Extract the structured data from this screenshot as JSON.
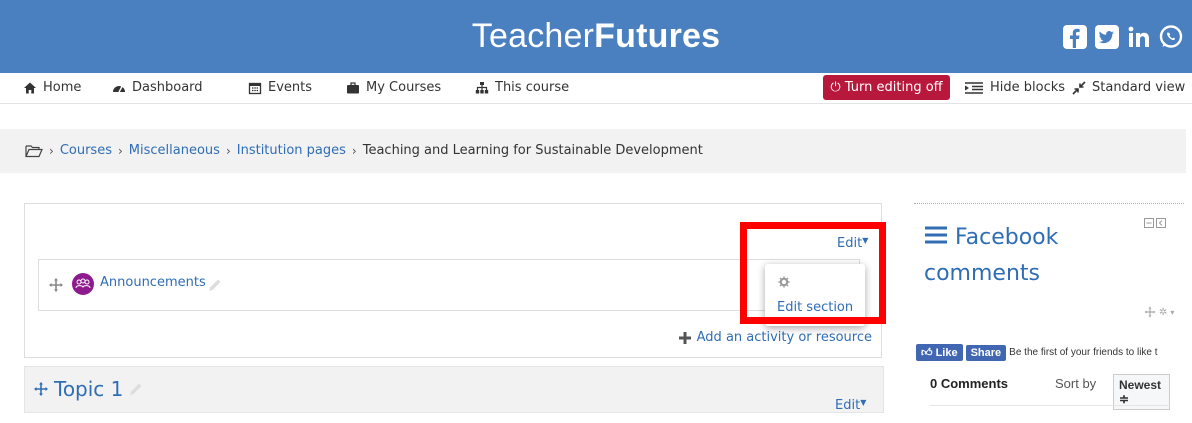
{
  "header": {
    "brand_thin": "Teacher",
    "brand_bold": "Futures",
    "social_icons": [
      "facebook-icon",
      "twitter-icon",
      "linkedin-icon",
      "whatsapp-icon"
    ]
  },
  "nav": {
    "home": "Home",
    "dashboard": "Dashboard",
    "events": "Events",
    "my_courses": "My Courses",
    "this_course": "This course",
    "turn_editing_off": "Turn editing off",
    "hide_blocks": "Hide blocks",
    "standard_view": "Standard view"
  },
  "breadcrumb": {
    "items": [
      "Courses",
      "Miscellaneous",
      "Institution pages",
      "Teaching and Learning for Sustainable Development"
    ]
  },
  "section0": {
    "edit_label": "Edit",
    "activity_name": "Announcements",
    "add_activity": "Add an activity or resource",
    "popup_edit_section": "Edit section"
  },
  "topic1": {
    "title": "Topic 1",
    "edit_label": "Edit"
  },
  "block": {
    "title": "Facebook comments",
    "like": "Like",
    "share": "Share",
    "like_text": "Be the first of your friends to like t",
    "comments_count": "0 Comments",
    "sort_by": "Sort by",
    "sort_value": "Newest ≑"
  },
  "colors": {
    "header_bg": "#4a7fc0",
    "link": "#2f6db5",
    "edit_off_bg": "#b8183c",
    "highlight": "#ff0000"
  }
}
